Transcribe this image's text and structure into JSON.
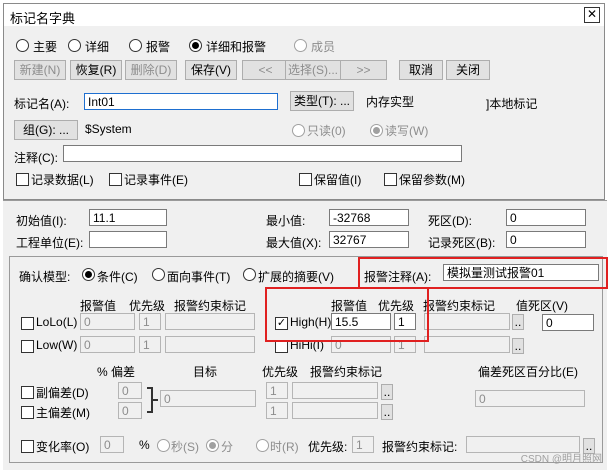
{
  "window": {
    "title": "标记名字典",
    "close": "✕"
  },
  "view_modes": [
    {
      "label": "主要",
      "selected": false,
      "enabled": true
    },
    {
      "label": "详细",
      "selected": false,
      "enabled": true
    },
    {
      "label": "报警",
      "selected": false,
      "enabled": true
    },
    {
      "label": "详细和报警",
      "selected": true,
      "enabled": true
    },
    {
      "label": "成员",
      "selected": false,
      "enabled": false
    }
  ],
  "toolbar": {
    "new": "新建(N)",
    "restore": "恢复(R)",
    "delete": "删除(D)",
    "save": "保存(V)",
    "prev": "<<",
    "select": "选择(S)...",
    "next": ">>",
    "cancel": "取消",
    "close": "关闭"
  },
  "tag": {
    "name_label": "标记名(A):",
    "name_value": "Int01",
    "type_button": "类型(T): ...",
    "type_value": "内存实型",
    "local_tag": "]本地标记",
    "group_button": "组(G): ...",
    "group_value": "$System",
    "readonly": "只读(0)",
    "readwrite": "读写(W)",
    "comment_label": "注释(C):",
    "comment_value": ""
  },
  "logging": {
    "log_data": "记录数据(L)",
    "log_events": "记录事件(E)",
    "retentive_value": "保留值(I)",
    "retentive_params": "保留参数(M)"
  },
  "details": {
    "initial_label": "初始值(I):",
    "initial_value": "11.1",
    "min_label": "最小值:",
    "min_value": "-32768",
    "deadband_label": "死区(D):",
    "deadband_value": "0",
    "units_label": "工程单位(E):",
    "units_value": "",
    "max_label": "最大值(X):",
    "max_value": "32767",
    "log_deadband_label": "记录死区(B):",
    "log_deadband_value": "0"
  },
  "ack": {
    "model_label": "确认模型:",
    "condition": "条件(C)",
    "event": "面向事件(T)",
    "extended": "扩展的摘要(V)",
    "alarm_comment_label": "报警注释(A):",
    "alarm_comment_value": "模拟量测试报警01"
  },
  "limits": {
    "header_value": "报警值",
    "header_priority": "优先级",
    "header_constraint": "报警约束标记",
    "deadband_header": "值死区(V)",
    "deadband_value": "0",
    "dots": "..",
    "lolo": {
      "label": "LoLo(L)",
      "value": "0",
      "priority": "1",
      "checked": false
    },
    "low": {
      "label": "Low(W)",
      "value": "0",
      "priority": "1",
      "checked": false
    },
    "high": {
      "label": "High(H)",
      "value": "15.5",
      "priority": "1",
      "checked": true
    },
    "hihi": {
      "label": "HiHi(I)",
      "value": "0",
      "priority": "1",
      "checked": false
    }
  },
  "deviation": {
    "percent_header": "% 偏差",
    "target_header": "目标",
    "priority_header": "优先级",
    "constraint_header": "报警约束标记",
    "deadband_header": "偏差死区百分比(E)",
    "minor": "副偏差(D)",
    "major": "主偏差(M)",
    "minor_value": "0",
    "major_value": "0",
    "target_value": "0",
    "minor_priority": "1",
    "major_priority": "1",
    "deadband_value": "0"
  },
  "roc": {
    "label": "变化率(O)",
    "value": "0",
    "percent": "%",
    "sec": "秒(S)",
    "min": "分",
    "hour": "时(R)",
    "priority_label": "优先级:",
    "priority_value": "1",
    "constraint_label": "报警约束标记:"
  },
  "watermark": "CSDN @明月照网"
}
